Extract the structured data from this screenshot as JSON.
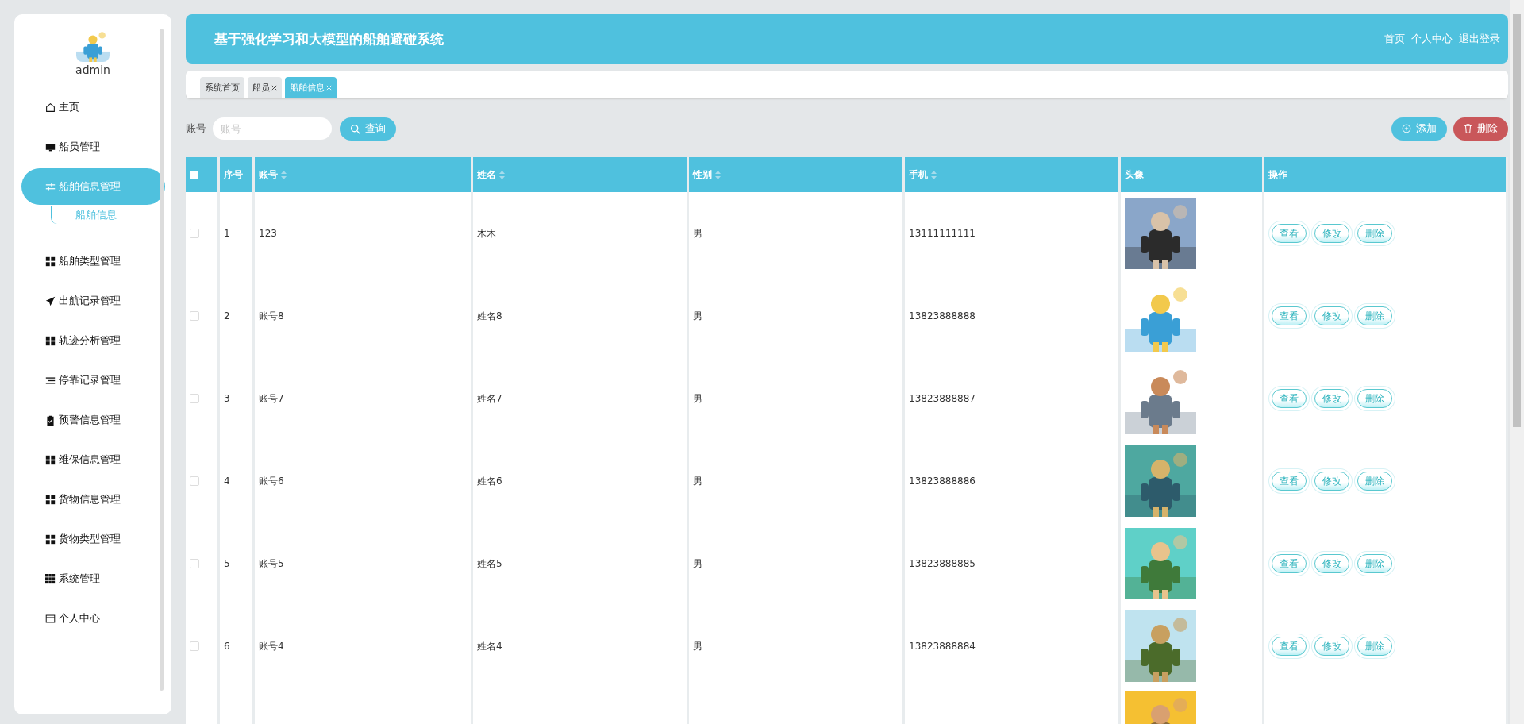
{
  "sidebar": {
    "user": "admin",
    "items": [
      {
        "label": "主页",
        "selected": false
      },
      {
        "label": "船员管理",
        "selected": false
      },
      {
        "label": "船舶信息管理",
        "selected": true,
        "expanded": true,
        "children": [
          {
            "label": "船舶信息",
            "selected": true
          }
        ]
      },
      {
        "label": "船舶类型管理",
        "selected": false
      },
      {
        "label": "出航记录管理",
        "selected": false
      },
      {
        "label": "轨迹分析管理",
        "selected": false
      },
      {
        "label": "停靠记录管理",
        "selected": false
      },
      {
        "label": "预警信息管理",
        "selected": false
      },
      {
        "label": "维保信息管理",
        "selected": false
      },
      {
        "label": "货物信息管理",
        "selected": false
      },
      {
        "label": "货物类型管理",
        "selected": false
      },
      {
        "label": "系统管理",
        "selected": false
      },
      {
        "label": "个人中心",
        "selected": false
      }
    ]
  },
  "header": {
    "title": "基于强化学习和大模型的船舶避碰系统",
    "links": [
      "首页",
      "个人中心",
      "退出登录"
    ]
  },
  "tabs": [
    {
      "label": "系统首页",
      "closable": false,
      "selected": false
    },
    {
      "label": "船员",
      "closable": true,
      "selected": false
    },
    {
      "label": "船舶信息",
      "closable": true,
      "selected": true
    }
  ],
  "search": {
    "label": "账号",
    "placeholder": "账号",
    "button": "查询"
  },
  "actions": [
    {
      "label": "添加",
      "kind": "add"
    },
    {
      "label": "删除",
      "kind": "delete"
    }
  ],
  "table": {
    "all_checked": false,
    "columns": [
      {
        "label": "序号",
        "sortable": false
      },
      {
        "label": "账号",
        "sortable": true
      },
      {
        "label": "姓名",
        "sortable": true
      },
      {
        "label": "性别",
        "sortable": true
      },
      {
        "label": "手机",
        "sortable": true
      },
      {
        "label": "头像",
        "sortable": false
      },
      {
        "label": "操作",
        "sortable": false
      }
    ],
    "rows": [
      {
        "checked": false,
        "cells": [
          "1",
          "123",
          "木木",
          "男",
          "13111111111"
        ],
        "avatar": {
          "kind": "picture"
        },
        "buttons": [
          "查看",
          "修改",
          "删除"
        ]
      },
      {
        "checked": false,
        "cells": [
          "2",
          "账号8",
          "姓名8",
          "男",
          "13823888888"
        ],
        "avatar": {
          "kind": "picture"
        },
        "buttons": [
          "查看",
          "修改",
          "删除"
        ]
      },
      {
        "checked": false,
        "cells": [
          "3",
          "账号7",
          "姓名7",
          "男",
          "13823888887"
        ],
        "avatar": {
          "kind": "picture"
        },
        "buttons": [
          "查看",
          "修改",
          "删除"
        ]
      },
      {
        "checked": false,
        "cells": [
          "4",
          "账号6",
          "姓名6",
          "男",
          "13823888886"
        ],
        "avatar": {
          "kind": "picture"
        },
        "buttons": [
          "查看",
          "修改",
          "删除"
        ]
      },
      {
        "checked": false,
        "cells": [
          "5",
          "账号5",
          "姓名5",
          "男",
          "13823888885"
        ],
        "avatar": {
          "kind": "picture"
        },
        "buttons": [
          "查看",
          "修改",
          "删除"
        ]
      },
      {
        "checked": false,
        "cells": [
          "6",
          "账号4",
          "姓名4",
          "男",
          "13823888884"
        ],
        "avatar": {
          "kind": "picture"
        },
        "buttons": [
          "查看",
          "修改",
          "删除"
        ]
      },
      {
        "avatar": {
          "kind": "picture"
        }
      }
    ]
  }
}
